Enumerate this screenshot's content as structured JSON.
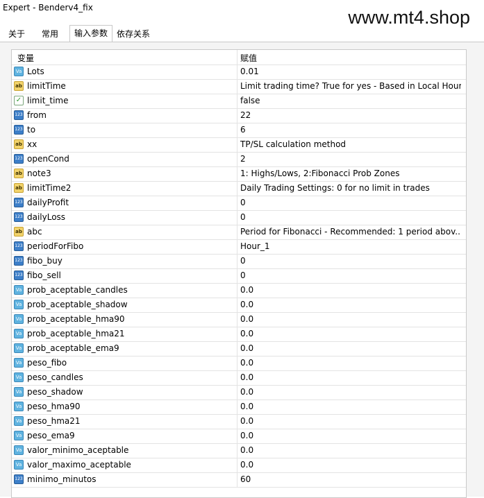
{
  "window": {
    "title": "Expert - Benderv4_fix"
  },
  "watermark": "www.mt4.shop",
  "tabs": [
    {
      "label": "关于",
      "active": false
    },
    {
      "label": "常用",
      "active": false
    },
    {
      "label": "输入参数",
      "active": true
    },
    {
      "label": "依存关系",
      "active": false
    }
  ],
  "table": {
    "headers": {
      "variable": "变量",
      "value": "赋值"
    },
    "rows": [
      {
        "icon": "va",
        "name": "Lots",
        "value": "0.01"
      },
      {
        "icon": "ab",
        "name": "limitTime",
        "value": "Limit trading time? True for yes - Based in Local Hour"
      },
      {
        "icon": "bool",
        "name": "limit_time",
        "value": "false"
      },
      {
        "icon": "n123",
        "name": "from",
        "value": "22"
      },
      {
        "icon": "n123",
        "name": "to",
        "value": "6"
      },
      {
        "icon": "ab",
        "name": "xx",
        "value": "TP/SL calculation method"
      },
      {
        "icon": "n123",
        "name": "openCond",
        "value": "2"
      },
      {
        "icon": "ab",
        "name": "note3",
        "value": "1: Highs/Lows, 2:Fibonacci Prob Zones"
      },
      {
        "icon": "ab",
        "name": "limitTime2",
        "value": "Daily Trading Settings: 0 for no limit in trades"
      },
      {
        "icon": "n123",
        "name": "dailyProfit",
        "value": "0"
      },
      {
        "icon": "n123",
        "name": "dailyLoss",
        "value": "0"
      },
      {
        "icon": "ab",
        "name": "abc",
        "value": "Period for Fibonacci - Recommended: 1 period abov..."
      },
      {
        "icon": "n123",
        "name": "periodForFibo",
        "value": "Hour_1"
      },
      {
        "icon": "n123",
        "name": "fibo_buy",
        "value": "0"
      },
      {
        "icon": "n123",
        "name": "fibo_sell",
        "value": "0"
      },
      {
        "icon": "va",
        "name": "prob_aceptable_candles",
        "value": "0.0"
      },
      {
        "icon": "va",
        "name": "prob_aceptable_shadow",
        "value": "0.0"
      },
      {
        "icon": "va",
        "name": "prob_aceptable_hma90",
        "value": "0.0"
      },
      {
        "icon": "va",
        "name": "prob_aceptable_hma21",
        "value": "0.0"
      },
      {
        "icon": "va",
        "name": "prob_aceptable_ema9",
        "value": "0.0"
      },
      {
        "icon": "va",
        "name": "peso_fibo",
        "value": "0.0"
      },
      {
        "icon": "va",
        "name": "peso_candles",
        "value": "0.0"
      },
      {
        "icon": "va",
        "name": "peso_shadow",
        "value": "0.0"
      },
      {
        "icon": "va",
        "name": "peso_hma90",
        "value": "0.0"
      },
      {
        "icon": "va",
        "name": "peso_hma21",
        "value": "0.0"
      },
      {
        "icon": "va",
        "name": "peso_ema9",
        "value": "0.0"
      },
      {
        "icon": "va",
        "name": "valor_minimo_aceptable",
        "value": "0.0"
      },
      {
        "icon": "va",
        "name": "valor_maximo_aceptable",
        "value": "0.0"
      },
      {
        "icon": "n123",
        "name": "minimo_minutos",
        "value": "60"
      }
    ]
  }
}
